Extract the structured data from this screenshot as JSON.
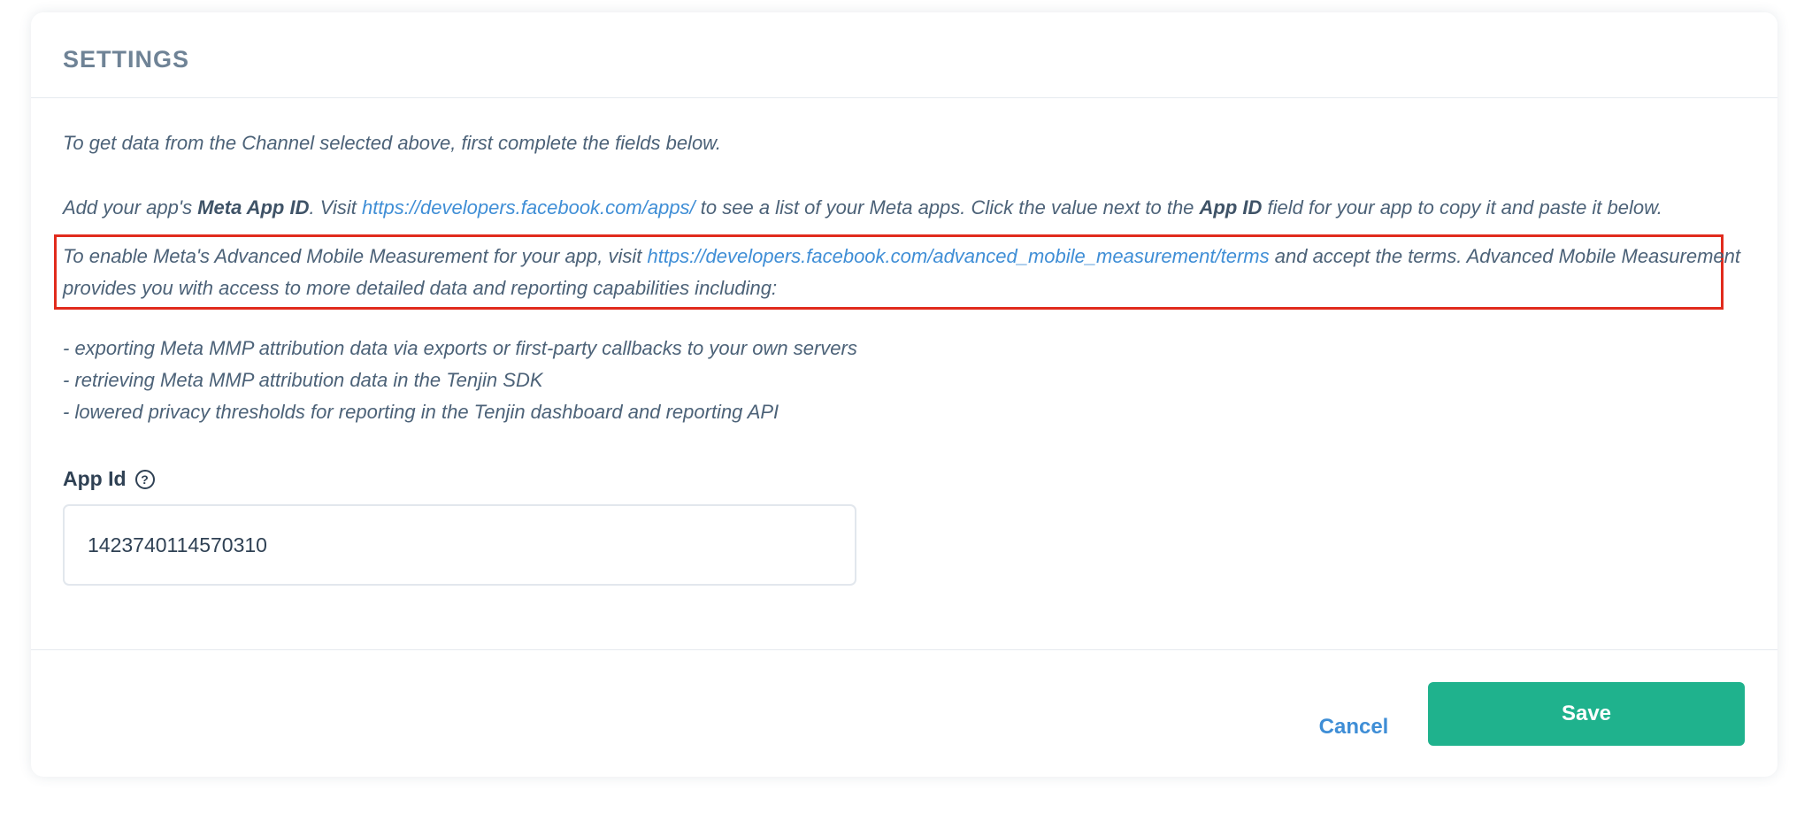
{
  "header": {
    "title": "SETTINGS"
  },
  "intro": {
    "text": "To get data from the Channel selected above, first complete the fields below."
  },
  "app_id_help": {
    "part1": "Add your app's ",
    "bold1": "Meta App ID",
    "part2": ". Visit ",
    "link": "https://developers.facebook.com/apps/",
    "part3": " to see a list of your Meta apps. Click the value next to the ",
    "bold2": "App ID",
    "part4": " field for your app to copy it and paste it below."
  },
  "amm": {
    "part1": "To enable Meta's Advanced Mobile Measurement for your app, visit ",
    "link": "https://developers.facebook.com/advanced_mobile_measurement/terms",
    "part2": " and accept the terms. Advanced Mobile Measurement provides you with access to more detailed data and reporting capabilities including:"
  },
  "capabilities": [
    "- exporting Meta MMP attribution data via exports or first-party callbacks to your own servers",
    "- retrieving Meta MMP attribution data in the Tenjin SDK",
    "- lowered privacy thresholds for reporting in the Tenjin dashboard and reporting API"
  ],
  "field": {
    "label": "App Id",
    "help_glyph": "?",
    "value": "1423740114570310"
  },
  "footer": {
    "cancel_label": "Cancel",
    "save_label": "Save"
  },
  "colors": {
    "accent": "#1fb28d",
    "link": "#3f8ed6",
    "highlight_border": "#e12b1d",
    "title": "#6f8396",
    "body_text": "#4c6278"
  }
}
